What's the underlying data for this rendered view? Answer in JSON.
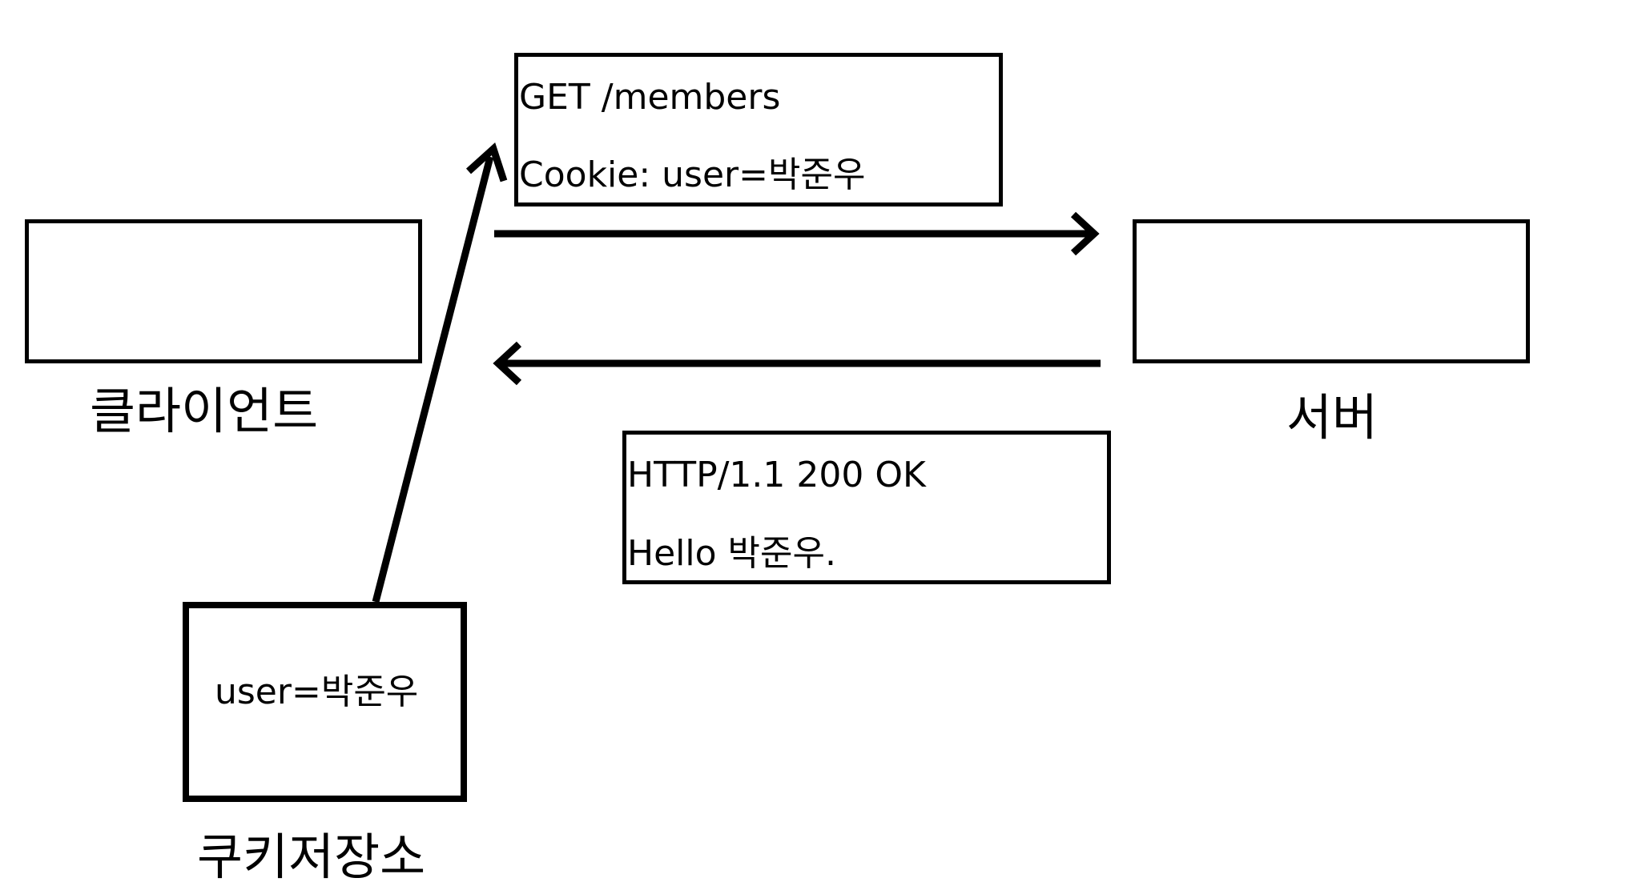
{
  "client": {
    "label": "클라이언트"
  },
  "server": {
    "label": "서버"
  },
  "cookie_store": {
    "label": "쿠키저장소",
    "content": "user=박준우"
  },
  "request": {
    "line1": "GET /members",
    "line2": "Cookie: user=박준우"
  },
  "response": {
    "line1": "HTTP/1.1 200 OK",
    "line2": "Hello 박준우."
  }
}
